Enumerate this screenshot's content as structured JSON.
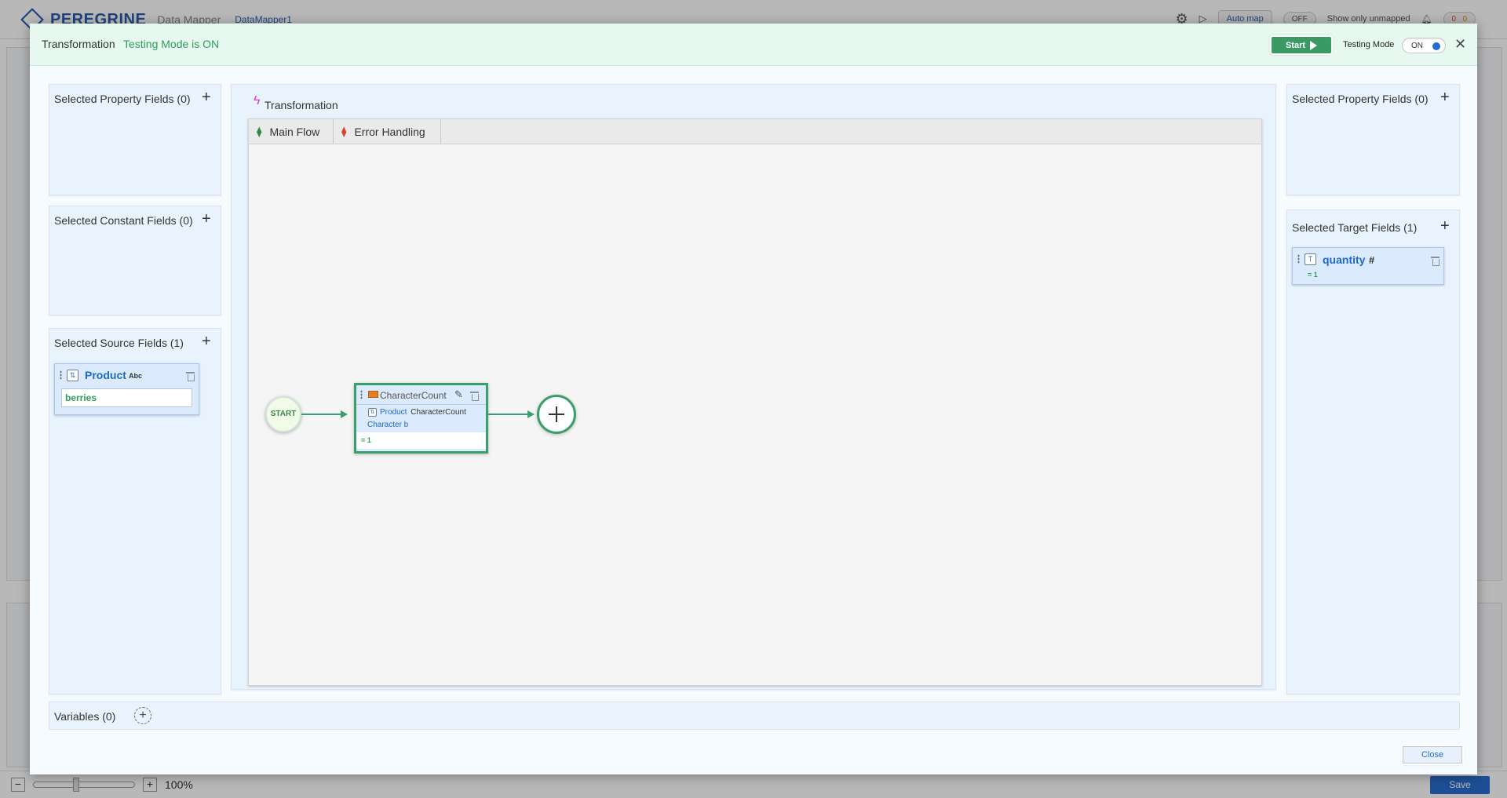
{
  "background": {
    "app_name": "PEREGRINE",
    "app_subtitle": "Data Mapper",
    "mapper_name": "DataMapper1",
    "auto_map": "Auto map",
    "toggle_off": "OFF",
    "show_unmapped": "Show only unmapped",
    "notif_a": "0",
    "notif_b": "0",
    "zoom_level": "100%",
    "save_label": "Save"
  },
  "modal": {
    "title": "Transformation",
    "mode_status": "Testing Mode is ON",
    "start_label": "Start",
    "testing_mode_label": "Testing Mode",
    "testing_toggle_text": "ON",
    "close_label": "Close"
  },
  "left": {
    "property_fields_title": "Selected Property Fields (0)",
    "constant_fields_title": "Selected Constant Fields (0)",
    "source_fields_title": "Selected Source Fields (1)",
    "source_field": {
      "name": "Product",
      "type": "Abc",
      "test_value": "berries"
    }
  },
  "center": {
    "title": "Transformation",
    "tabs": [
      {
        "label": "Main Flow"
      },
      {
        "label": "Error Handling"
      }
    ],
    "start_node": "START",
    "function_node": {
      "title": "CharacterCount",
      "input_field": "Product",
      "function": "CharacterCount",
      "output": "Character b",
      "result": "= 1"
    }
  },
  "right": {
    "property_fields_title": "Selected Property Fields (0)",
    "target_fields_title": "Selected Target Fields (1)",
    "target_field": {
      "name": "quantity",
      "type": "#",
      "result": "= 1"
    }
  },
  "variables": {
    "title": "Variables (0)"
  },
  "colors": {
    "accent_green": "#3aa06a",
    "link_blue": "#1e6bc6",
    "header_bg": "#e6f8ef",
    "panel_bg": "#e9f3fd"
  }
}
